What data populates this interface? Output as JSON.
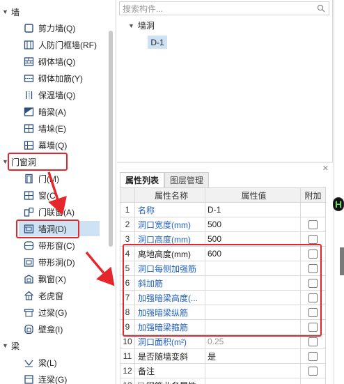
{
  "left_tree": {
    "categories": [
      {
        "label": "墙"
      },
      {
        "label": "门窗洞"
      },
      {
        "label": "梁"
      }
    ],
    "wall_items": [
      {
        "label": "剪力墙(Q)",
        "icon": "shear-wall-icon"
      },
      {
        "label": "人防门框墙(RF)",
        "icon": "civil-defense-door-frame-wall-icon"
      },
      {
        "label": "砌体墙(Q)",
        "icon": "masonry-wall-icon"
      },
      {
        "label": "砌体加筋(Y)",
        "icon": "masonry-reinforcement-icon"
      },
      {
        "label": "保温墙(Q)",
        "icon": "insulation-wall-icon"
      },
      {
        "label": "暗梁(A)",
        "icon": "hidden-beam-icon"
      },
      {
        "label": "墙垛(E)",
        "icon": "wall-pier-icon"
      },
      {
        "label": "幕墙(Q)",
        "icon": "curtain-wall-icon"
      }
    ],
    "opening_items": [
      {
        "label": "门(M)",
        "icon": "door-icon"
      },
      {
        "label": "窗(C)",
        "icon": "window-icon"
      },
      {
        "label": "门联窗(A)",
        "icon": "door-window-icon"
      },
      {
        "label": "墙洞(D)",
        "icon": "wall-opening-icon"
      },
      {
        "label": "带形窗(C)",
        "icon": "strip-window-icon"
      },
      {
        "label": "带形洞(D)",
        "icon": "strip-opening-icon"
      },
      {
        "label": "飘窗(X)",
        "icon": "bay-window-icon"
      },
      {
        "label": "老虎窗",
        "icon": "dormer-window-icon"
      },
      {
        "label": "过梁(G)",
        "icon": "lintel-icon"
      },
      {
        "label": "壁龛(I)",
        "icon": "niche-icon"
      }
    ],
    "beam_items": [
      {
        "label": "梁(L)",
        "icon": "beam-icon"
      },
      {
        "label": "连梁(G)",
        "icon": "coupling-beam-icon"
      }
    ],
    "selected": "墙洞(D)"
  },
  "component_tree": {
    "search_placeholder": "搜索构件...",
    "category": "墙洞",
    "items": [
      "D-1"
    ]
  },
  "properties": {
    "tabs": [
      "属性列表",
      "图层管理"
    ],
    "active_tab": "属性列表",
    "headers": {
      "num": "",
      "name": "属性名称",
      "value": "属性值",
      "add": "附加"
    },
    "rows": [
      {
        "num": "1",
        "name": "名称",
        "value": "D-1",
        "name_color": "blue",
        "value_color": "normal",
        "checkbox": false
      },
      {
        "num": "2",
        "name": "洞口宽度(mm)",
        "value": "500",
        "name_color": "blue",
        "value_color": "normal",
        "checkbox": true
      },
      {
        "num": "3",
        "name": "洞口高度(mm)",
        "value": "500",
        "name_color": "blue",
        "value_color": "normal",
        "checkbox": true
      },
      {
        "num": "4",
        "name": "离地高度(mm)",
        "value": "600",
        "name_color": "normal",
        "value_color": "normal",
        "checkbox": true
      },
      {
        "num": "5",
        "name": "洞口每侧加强筋",
        "value": "",
        "name_color": "blue",
        "value_color": "normal",
        "checkbox": true
      },
      {
        "num": "6",
        "name": "斜加筋",
        "value": "",
        "name_color": "blue",
        "value_color": "normal",
        "checkbox": true
      },
      {
        "num": "7",
        "name": "加强暗梁高度(...",
        "value": "",
        "name_color": "blue",
        "value_color": "normal",
        "checkbox": true
      },
      {
        "num": "8",
        "name": "加强暗梁纵筋",
        "value": "",
        "name_color": "blue",
        "value_color": "normal",
        "checkbox": true
      },
      {
        "num": "9",
        "name": "加强暗梁箍筋",
        "value": "",
        "name_color": "blue",
        "value_color": "normal",
        "checkbox": true
      },
      {
        "num": "10",
        "name": "洞口面积(m²)",
        "value": "0.25",
        "name_color": "blue",
        "value_color": "gray",
        "checkbox": true
      },
      {
        "num": "11",
        "name": "是否随墙变斜",
        "value": "是",
        "name_color": "normal",
        "value_color": "normal",
        "checkbox": true
      },
      {
        "num": "12",
        "name": "备注",
        "value": "",
        "name_color": "normal",
        "value_color": "normal",
        "checkbox": true
      },
      {
        "num": "13",
        "name": "钢筋业务属性",
        "value": "",
        "name_color": "normal",
        "value_color": "normal",
        "checkbox": false,
        "expander": "+"
      }
    ]
  },
  "colors": {
    "annotation_red": "#e5262b",
    "selection_blue": "#cfe2f3",
    "property_blue": "#1f5fbf"
  }
}
